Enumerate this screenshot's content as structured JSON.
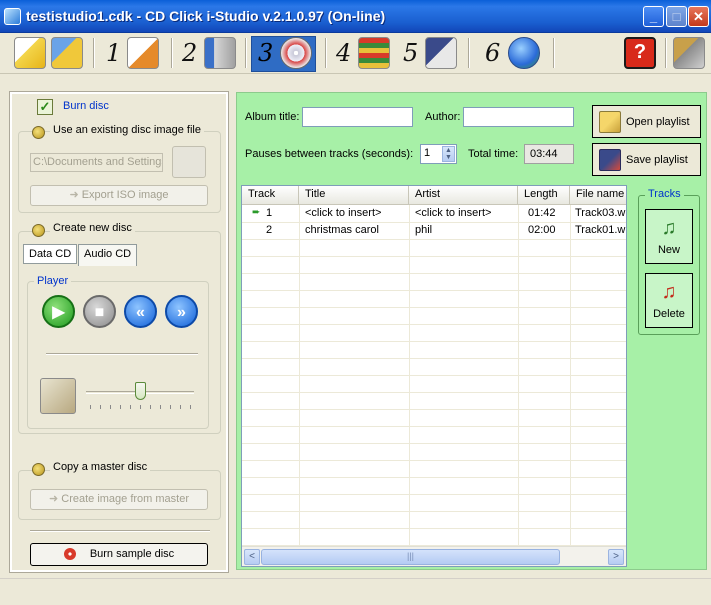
{
  "window": {
    "title": "testistudio1.cdk - CD Click i-Studio v.2.1.0.97 (On-line)",
    "minimize": "_",
    "maximize": "□",
    "close": "✕"
  },
  "toolbar": {
    "steps": [
      "1",
      "2",
      "3",
      "4",
      "5",
      "6"
    ],
    "help": "?",
    "icons": [
      "new-project-icon",
      "open-project-icon",
      "step1-edit-icon",
      "step2-media-icon",
      "step3-disc-icon",
      "step4-books-icon",
      "step5-save-icon",
      "step6-globe-icon",
      "help-icon",
      "tools-icon"
    ]
  },
  "left": {
    "burn_disc": "Burn disc",
    "use_existing": "Use an existing disc image file",
    "path_value": "C:\\Documents and Settings",
    "export_iso": "Export ISO image",
    "create_new": "Create new disc",
    "tabs": [
      "Data CD",
      "Audio CD"
    ],
    "player": "Player",
    "player_buttons": [
      "▶",
      "■",
      "«",
      "»"
    ],
    "copy_master": "Copy a master disc",
    "create_from_master": "Create image from master",
    "burn_sample": "Burn sample disc"
  },
  "playlist": {
    "album_label": "Album title:",
    "album_value": "",
    "author_label": "Author:",
    "author_value": "",
    "pauses_label": "Pauses between tracks (seconds):",
    "pauses_value": "1",
    "total_label": "Total time:",
    "total_value": "03:44",
    "open_playlist": "Open playlist",
    "save_playlist": "Save playlist"
  },
  "table": {
    "columns": [
      "Track",
      "Title",
      "Artist",
      "Length",
      "File name"
    ],
    "rows": [
      {
        "track": "1",
        "title": "<click to insert>",
        "artist": "<click to insert>",
        "length": "01:42",
        "file": "Track03.w"
      },
      {
        "track": "2",
        "title": "christmas carol",
        "artist": "phil",
        "length": "02:00",
        "file": "Track01.w"
      }
    ],
    "scroll_left": "<",
    "scroll_right": ">",
    "scroll_grip": "|||"
  },
  "tracks": {
    "label": "Tracks",
    "new": "New",
    "delete": "Delete"
  }
}
